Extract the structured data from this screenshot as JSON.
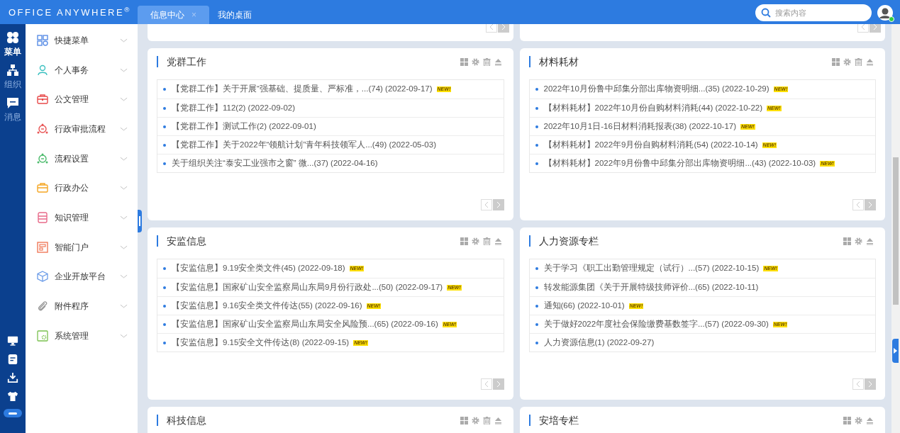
{
  "header": {
    "logo": "OFFICE ANYWHERE$^{®}$",
    "tabs": [
      {
        "label": "信息中心",
        "selected": true,
        "close": "×"
      },
      {
        "label": "我的桌面",
        "selected": false
      }
    ],
    "search": {
      "placeholder": "搜索内容"
    }
  },
  "rail": {
    "items": [
      {
        "label": "菜单",
        "selected": true
      },
      {
        "label": "组织",
        "selected": false
      },
      {
        "label": "消息",
        "selected": false
      }
    ],
    "tools": [
      {
        "kind": "monitor"
      },
      {
        "kind": "note"
      },
      {
        "kind": "download"
      },
      {
        "kind": "shirt"
      },
      {
        "kind": "toggle"
      }
    ]
  },
  "menu": [
    {
      "label": "快捷菜单"
    },
    {
      "label": "个人事务"
    },
    {
      "label": "公文管理"
    },
    {
      "label": "行政审批流程"
    },
    {
      "label": "流程设置"
    },
    {
      "label": "行政办公"
    },
    {
      "label": "知识管理"
    },
    {
      "label": "智能门户"
    },
    {
      "label": "企业开放平台"
    },
    {
      "label": "附件程序"
    },
    {
      "label": "系统管理"
    }
  ],
  "portlets": [
    {
      "title": "党群工作",
      "tools": [
        {
          "kind": "layout"
        },
        {
          "kind": "settings"
        },
        {
          "kind": "delete"
        },
        {
          "kind": "collapse"
        }
      ],
      "items": [
        {
          "text": "【党群工作】关于开展“强基础、提质量、严标准，...(74) (2022-09-17)",
          "badge": "NEW!"
        },
        {
          "text": "【党群工作】112(2) (2022-09-02)"
        },
        {
          "text": "【党群工作】测试工作(2) (2022-09-01)"
        },
        {
          "text": "【党群工作】关于2022年“领航计划”青年科技领军人...(49) (2022-05-03)"
        },
        {
          "text": "关于组织关注“泰安工业强市之窗” 微...(37) (2022-04-16)"
        }
      ]
    },
    {
      "title": "材料耗材",
      "tools": [
        {
          "kind": "layout"
        },
        {
          "kind": "settings"
        },
        {
          "kind": "delete"
        },
        {
          "kind": "collapse"
        }
      ],
      "items": [
        {
          "text": "2022年10月份鲁中邱集分部出库物资明细...(35) (2022-10-29)",
          "badge": "NEW!"
        },
        {
          "text": "【材料耗材】2022年10月份自购材料消耗(44) (2022-10-22)",
          "badge": "NEW!"
        },
        {
          "text": "2022年10月1日-16日材料消耗报表(38) (2022-10-17)",
          "badge": "NEW!"
        },
        {
          "text": "【材料耗材】2022年9月份自购材料消耗(54) (2022-10-14)",
          "badge": "NEW!"
        },
        {
          "text": "【材料耗材】2022年9月份鲁中邱集分部出库物资明细...(43) (2022-10-03)",
          "badge": "NEW!"
        }
      ]
    },
    {
      "title": "安监信息",
      "tools": [
        {
          "kind": "layout"
        },
        {
          "kind": "settings"
        },
        {
          "kind": "delete"
        },
        {
          "kind": "collapse"
        }
      ],
      "items": [
        {
          "text": "【安监信息】9.19安全类文件(45) (2022-09-18)",
          "badge": "NEW!"
        },
        {
          "text": "【安监信息】国家矿山安全监察局山东局9月份行政处...(50) (2022-09-17)",
          "badge": "NEW!"
        },
        {
          "text": "【安监信息】9.16安全类文件传达(55) (2022-09-16)",
          "badge": "NEW!"
        },
        {
          "text": "【安监信息】国家矿山安全监察局山东局安全风险预...(65) (2022-09-16)",
          "badge": "NEW!"
        },
        {
          "text": "【安监信息】9.15安全文件传达(8) (2022-09-15)",
          "badge": "NEW!"
        }
      ]
    },
    {
      "title": "人力资源专栏",
      "tools": [
        {
          "kind": "layout"
        },
        {
          "kind": "settings"
        },
        {
          "kind": "collapse"
        }
      ],
      "items": [
        {
          "text": "关于学习《职工出勤管理规定（试行）...(57) (2022-10-15)",
          "badge": "NEW!"
        },
        {
          "text": "转发能源集团《关于开展特级技师评价...(65) (2022-10-11)"
        },
        {
          "text": "通知(66) (2022-10-01)",
          "badge": "NEW!"
        },
        {
          "text": "关于做好2022年度社会保险缴费基数签字...(57) (2022-09-30)",
          "badge": "NEW!"
        },
        {
          "text": "人力资源信息(1) (2022-09-27)"
        }
      ]
    },
    {
      "title": "科技信息",
      "tools": [
        {
          "kind": "layout"
        },
        {
          "kind": "settings"
        },
        {
          "kind": "delete"
        },
        {
          "kind": "collapse"
        }
      ]
    },
    {
      "title": "安培专栏",
      "tools": [
        {
          "kind": "layout"
        },
        {
          "kind": "settings"
        },
        {
          "kind": "collapse"
        }
      ]
    }
  ]
}
